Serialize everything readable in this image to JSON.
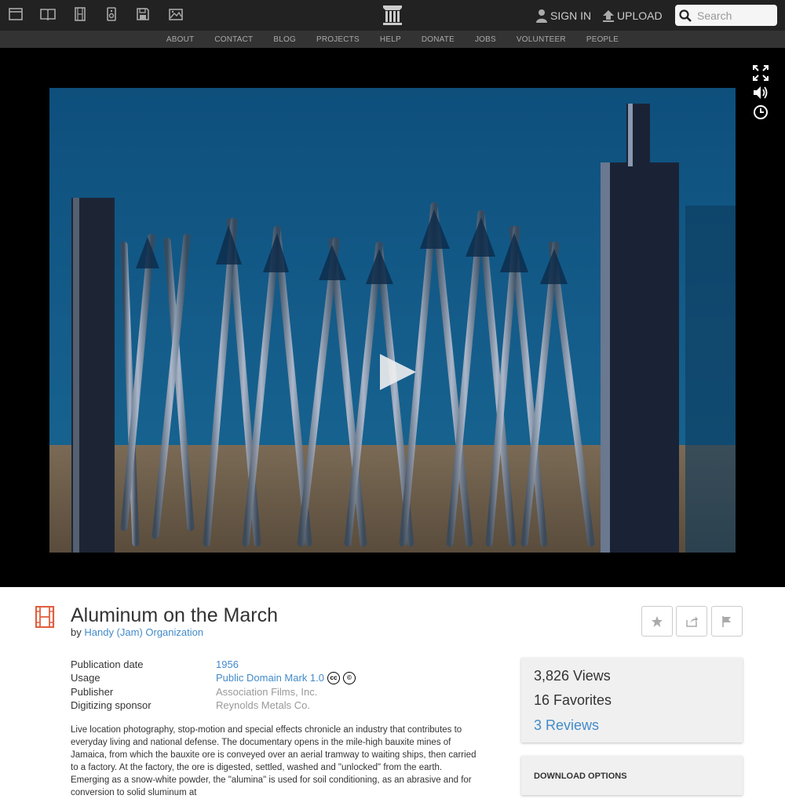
{
  "header": {
    "media_icons": [
      "web-icon",
      "texts-icon",
      "video-icon",
      "audio-icon",
      "software-icon",
      "images-icon"
    ],
    "logo": "archive-logo-icon",
    "sign_in": "SIGN IN",
    "upload": "UPLOAD",
    "search_placeholder": "Search"
  },
  "subnav": [
    "ABOUT",
    "CONTACT",
    "BLOG",
    "PROJECTS",
    "HELP",
    "DONATE",
    "JOBS",
    "VOLUNTEER",
    "PEOPLE"
  ],
  "player": {
    "controls": [
      "fullscreen-icon",
      "volume-icon",
      "speed-icon"
    ],
    "play": "play-icon"
  },
  "item": {
    "title": "Aluminum on the March",
    "by_prefix": "by",
    "creator": "Handy (Jam) Organization",
    "actions": [
      "favorite-icon",
      "share-icon",
      "flag-icon"
    ]
  },
  "metadata": {
    "publication_date_label": "Publication date",
    "publication_date": "1956",
    "usage_label": "Usage",
    "usage": "Public Domain Mark 1.0",
    "publisher_label": "Publisher",
    "publisher": "Association Films, Inc.",
    "sponsor_label": "Digitizing sponsor",
    "sponsor": "Reynolds Metals Co."
  },
  "description": "Live location photography, stop-motion and special effects chronicle an industry that contributes to everyday living and national defense. The documentary opens in the mile-high bauxite mines of Jamaica, from which the bauxite ore is conveyed over an aerial tramway to waiting ships, then carried to a factory. At the factory, the ore is digested, settled, washed and \"unlocked\" from the earth. Emerging as a snow-white powder, the \"alumina\" is used for soil conditioning, as an abrasive and for conversion to solid sluminum at",
  "stats": {
    "views": "3,826 Views",
    "favorites": "16 Favorites",
    "reviews": "3 Reviews"
  },
  "download": {
    "title": "DOWNLOAD OPTIONS"
  },
  "colors": {
    "topbar": "#222222",
    "subnav": "#333333",
    "link": "#428bca",
    "video_icon_accent": "#e06040"
  }
}
